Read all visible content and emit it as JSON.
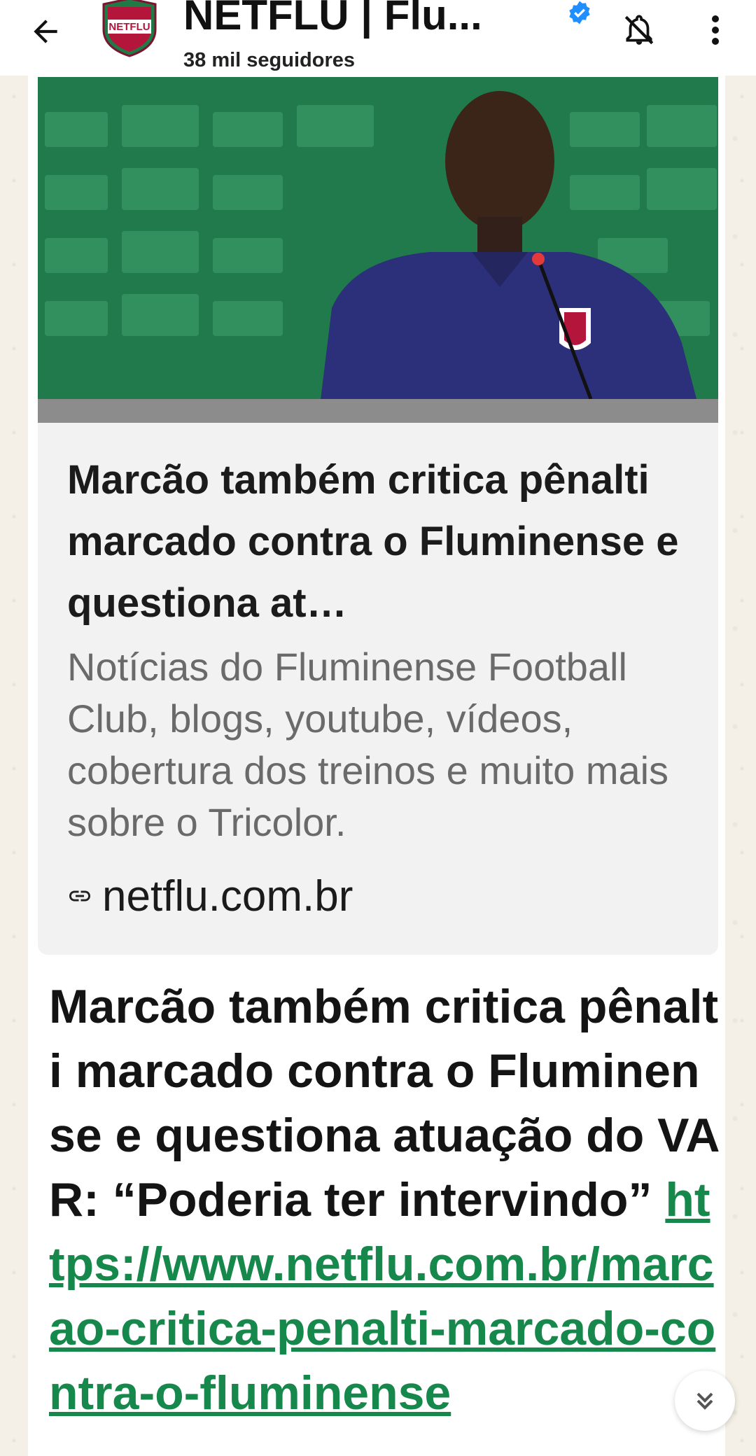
{
  "header": {
    "title": "NETFLU | Flu...",
    "subtitle": "38 mil seguidores",
    "avatar_text": "NETFLU",
    "accent": "#1f8a4c"
  },
  "icons": {
    "back": "arrow-left-icon",
    "verified": "verified-badge-icon",
    "mute": "bell-off-icon",
    "menu": "more-vert-icon",
    "link": "link-icon",
    "scroll": "double-chevron-down-icon"
  },
  "link_preview": {
    "title": "Marcão também critica pênalti marcado contra o Fluminense e questiona at…",
    "description": "Notícias do Fluminense Football Club, blogs, youtube, vídeos, cobertura dos treinos e muito mais sobre o Tricolor.",
    "domain": "netflu.com.br"
  },
  "message": {
    "text": "Marcão também critica pênalti marcado contra o Fluminense e questiona atuação do VAR: “Poderia ter intervindo” ",
    "link": "https://www.netflu.com.br/marcao-critica-penalti-marcado-contra-o-fluminense",
    "link_color": "#16884b"
  }
}
